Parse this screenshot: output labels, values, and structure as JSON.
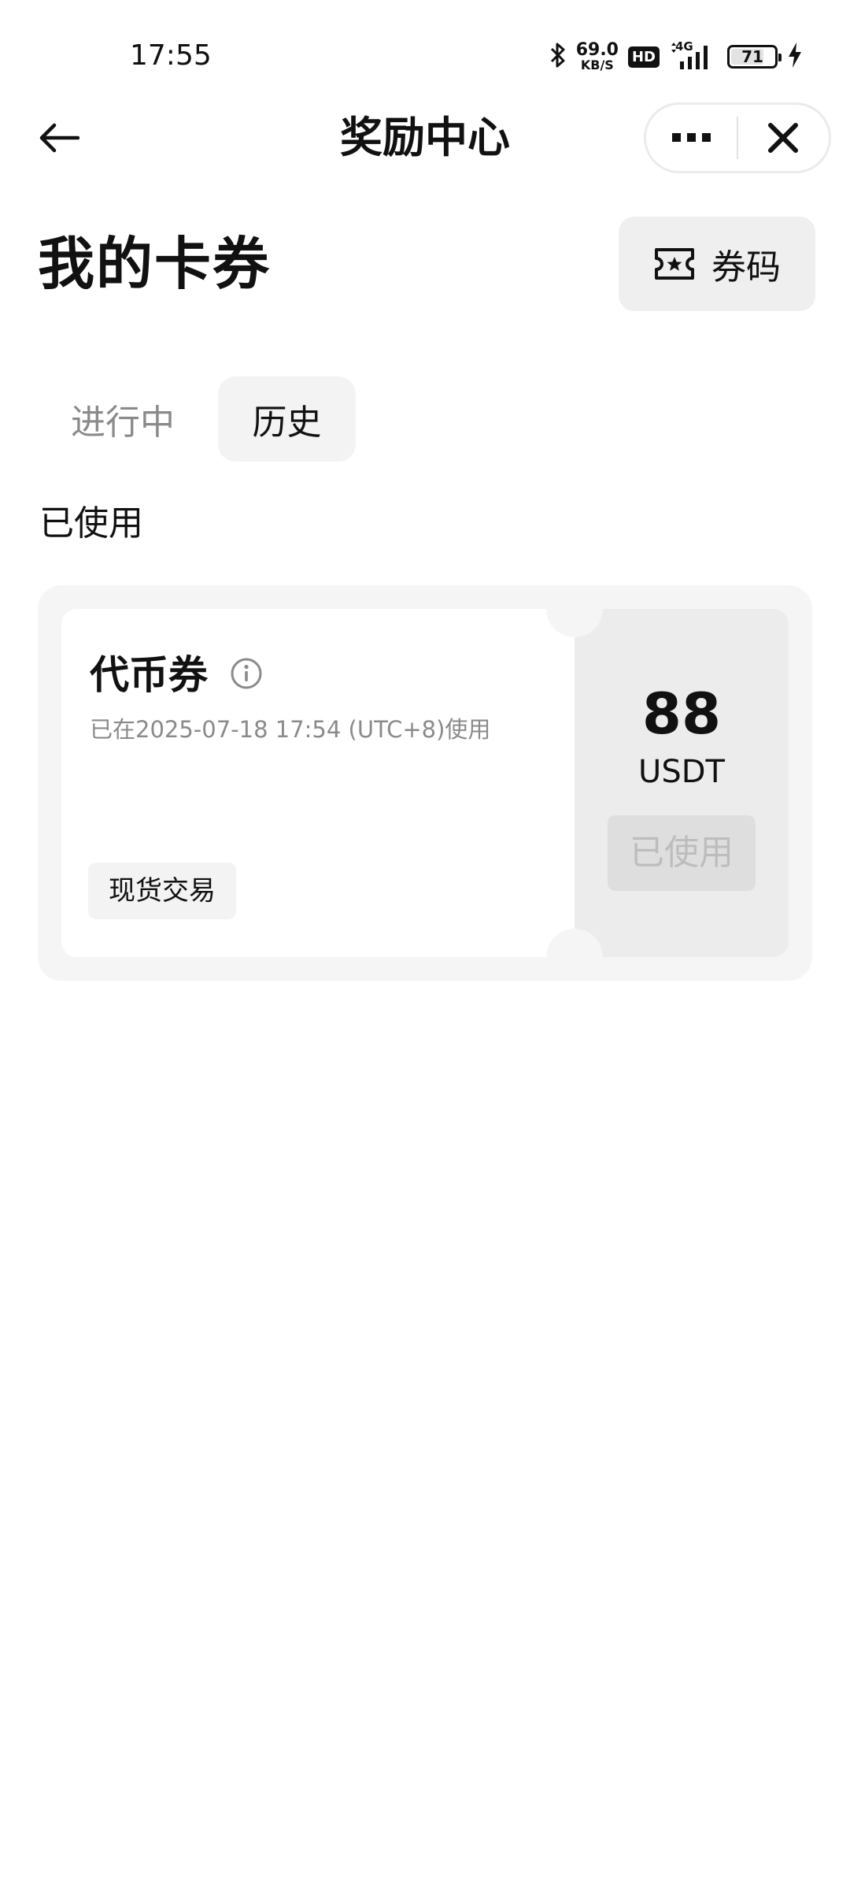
{
  "status_bar": {
    "time": "17:55",
    "net_speed_value": "69.0",
    "net_speed_unit": "KB/S",
    "hd_label": "HD",
    "network_label": "4G",
    "battery_level": "71",
    "icons": [
      "bluetooth-icon",
      "signal-icon",
      "charging-icon"
    ]
  },
  "nav": {
    "title": "奖励中心",
    "icons": [
      "back-arrow-icon",
      "more-icon",
      "close-icon"
    ]
  },
  "header": {
    "title": "我的卡券",
    "code_button_label": "券码",
    "code_button_icon": "ticket-icon"
  },
  "tabs": [
    {
      "label": "进行中",
      "active": false
    },
    {
      "label": "历史",
      "active": true
    }
  ],
  "section": {
    "title": "已使用"
  },
  "coupons": [
    {
      "title": "代币券",
      "info_icon": "info-icon",
      "used_text": "已在2025-07-18 17:54 (UTC+8)使用",
      "tag": "现货交易",
      "amount": "88",
      "currency": "USDT",
      "status": "已使用"
    }
  ],
  "colors": {
    "background": "#ffffff",
    "text_primary": "#111111",
    "text_secondary": "#8a8a8a",
    "tab_active_bg": "#f3f3f3",
    "card_bg": "#f5f5f5",
    "coupon_side_bg": "#ececec",
    "status_disabled_text": "#bdbdbd"
  }
}
